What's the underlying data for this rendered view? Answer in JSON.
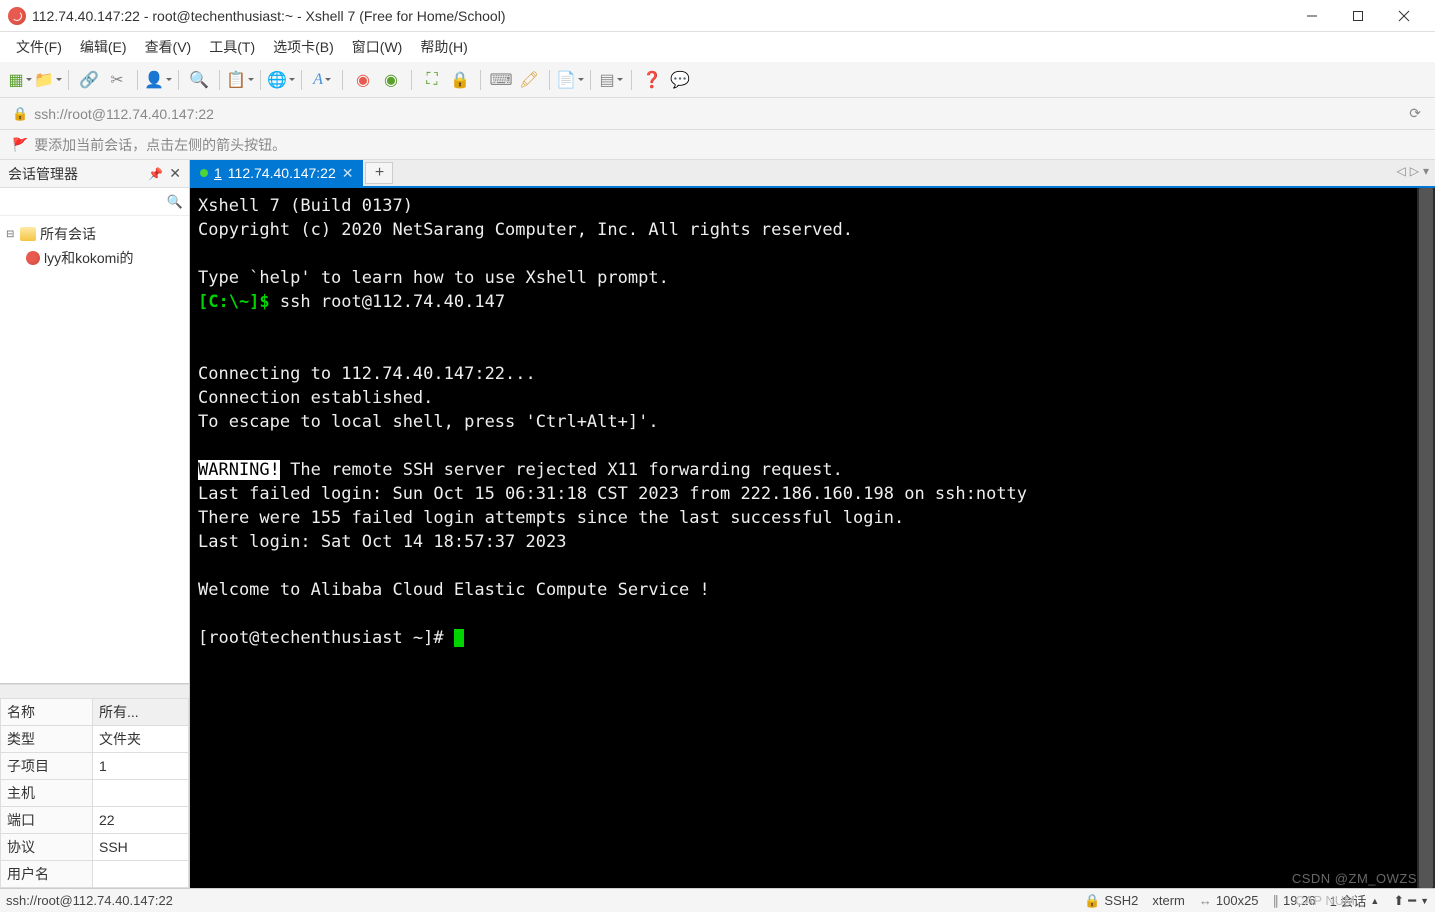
{
  "window": {
    "title": "112.74.40.147:22 - root@techenthusiast:~ - Xshell 7 (Free for Home/School)"
  },
  "menu": {
    "items": [
      "文件(F)",
      "编辑(E)",
      "查看(V)",
      "工具(T)",
      "选项卡(B)",
      "窗口(W)",
      "帮助(H)"
    ]
  },
  "address": {
    "url": "ssh://root@112.74.40.147:22",
    "recreate": "⟳"
  },
  "hint": {
    "text": "要添加当前会话，点击左侧的箭头按钮。"
  },
  "sidebar": {
    "title": "会话管理器",
    "tree": {
      "root": "所有会话",
      "child": "lyy和kokomi的"
    },
    "prop_headers": [
      "名称",
      "所有..."
    ],
    "props": [
      [
        "类型",
        "文件夹"
      ],
      [
        "子项目",
        "1"
      ],
      [
        "主机",
        ""
      ],
      [
        "端口",
        "22"
      ],
      [
        "协议",
        "SSH"
      ],
      [
        "用户名",
        ""
      ]
    ]
  },
  "tab": {
    "num": "1",
    "label": "112.74.40.147:22"
  },
  "term": {
    "l0": "Xshell 7 (Build 0137)",
    "l1": "Copyright (c) 2020 NetSarang Computer, Inc. All rights reserved.",
    "l2": "Type `help' to learn how to use Xshell prompt.",
    "p1": "[C:\\~]$ ",
    "c1": "ssh root@112.74.40.147",
    "l3": "Connecting to 112.74.40.147:22...",
    "l4": "Connection established.",
    "l5": "To escape to local shell, press 'Ctrl+Alt+]'.",
    "w": "WARNING!",
    "l6": " The remote SSH server rejected X11 forwarding request.",
    "l7": "Last failed login: Sun Oct 15 06:31:18 CST 2023 from 222.186.160.198 on ssh:notty",
    "l8": "There were 155 failed login attempts since the last successful login.",
    "l9": "Last login: Sat Oct 14 18:57:37 2023",
    "l10": "Welcome to Alibaba Cloud Elastic Compute Service !",
    "p2": "[root@techenthusiast ~]# "
  },
  "status": {
    "addr": "ssh://root@112.74.40.147:22",
    "proto": "SSH2",
    "term": "xterm",
    "size": "100x25",
    "pos": "19,26",
    "sess": "1 会话",
    "cap": "CAP   NUM"
  },
  "watermark": "CSDN @ZM_OWZS"
}
